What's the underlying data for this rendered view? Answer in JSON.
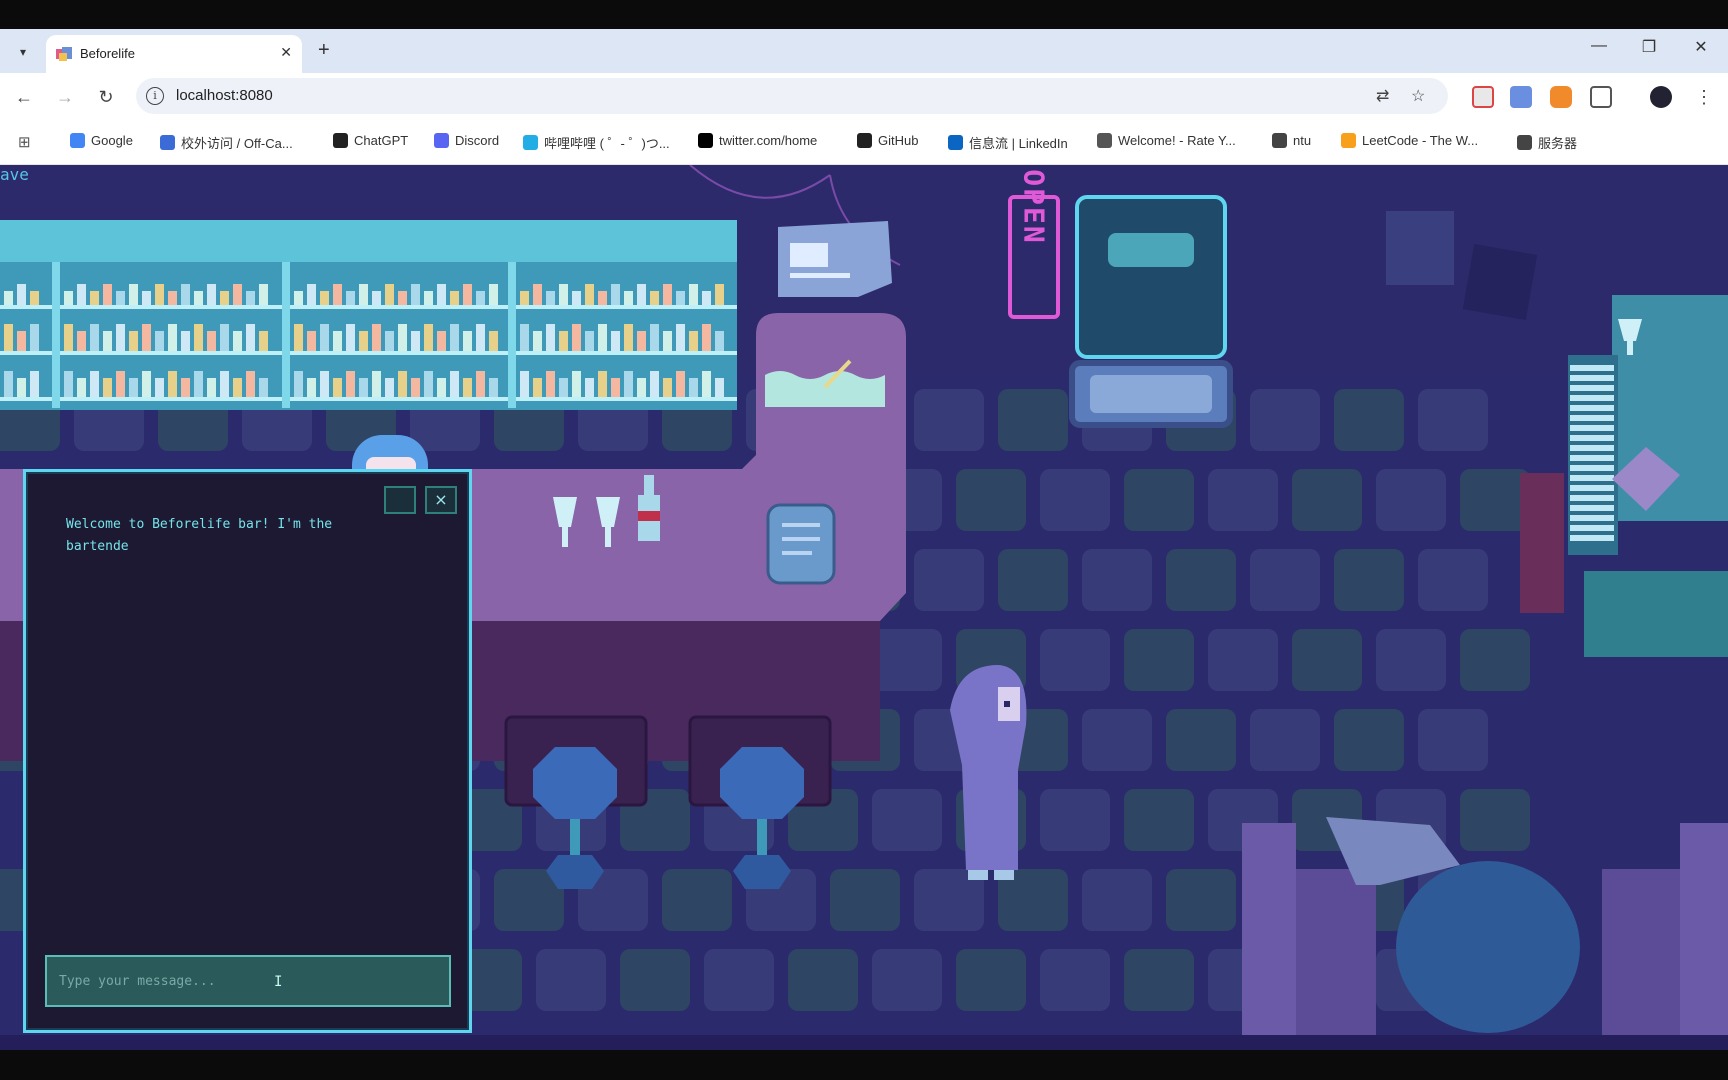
{
  "browser": {
    "tab_title": "Beforelife",
    "url": "localhost:8080",
    "bookmarks": [
      {
        "label": "Google",
        "color": "#4285f4"
      },
      {
        "label": "校外访问 / Off-Ca...",
        "color": "#3b6bd6"
      },
      {
        "label": "ChatGPT",
        "color": "#222222"
      },
      {
        "label": "Discord",
        "color": "#5865f2"
      },
      {
        "label": "哔哩哔哩 ( ゜- ゜)つ...",
        "color": "#23ade5"
      },
      {
        "label": "twitter.com/home",
        "color": "#000000"
      },
      {
        "label": "GitHub",
        "color": "#222222"
      },
      {
        "label": "信息流 | LinkedIn",
        "color": "#0a66c2"
      },
      {
        "label": "Welcome! - Rate Y...",
        "color": "#555555"
      },
      {
        "label": "ntu",
        "color": "#444444"
      },
      {
        "label": "LeetCode - The W...",
        "color": "#f89f1b"
      },
      {
        "label": "服务器",
        "color": "#444444"
      }
    ],
    "icons": {
      "back": "←",
      "forward": "→",
      "reload": "↻",
      "close": "✕",
      "new_tab": "+",
      "minimize": "—",
      "restore": "❐",
      "window_close": "✕"
    }
  },
  "game": {
    "save_label": "ave",
    "neon_sign": "OPEN",
    "chat": {
      "message": "Welcome to Beforelife bar! I'm the bartende",
      "placeholder": "Type your message...",
      "close_label": "×"
    },
    "colors": {
      "floor_dark": "#2a2766",
      "floor_tile": "#3a3f7a",
      "floor_tile_alt": "#2f4a63",
      "wall": "#2c2a6b",
      "counter": "#8a64a8",
      "shelf": "#5cc3d8",
      "neon": "#e05ad8"
    }
  }
}
